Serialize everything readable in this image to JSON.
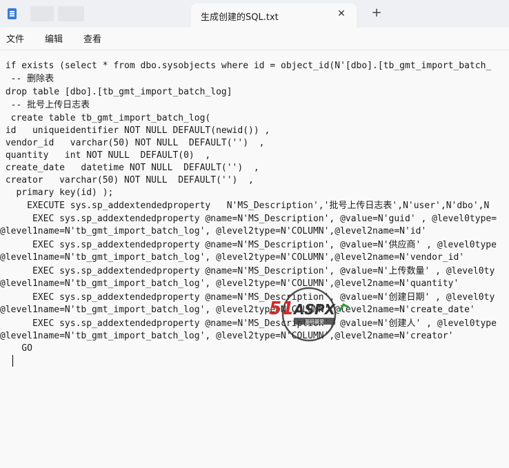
{
  "window": {
    "tab_title": "生成创建的SQL.txt",
    "close_glyph": "✕",
    "new_tab_glyph": "+"
  },
  "menu": {
    "file": "文件",
    "edit": "编辑",
    "view": "查看"
  },
  "editor": {
    "lines": [
      " if exists (select * from dbo.sysobjects where id = object_id(N'[dbo].[tb_gmt_import_batch_",
      "  -- 删除表",
      " drop table [dbo].[tb_gmt_import_batch_log]",
      "  -- 批号上传日志表",
      "  create table tb_gmt_import_batch_log(",
      " id   uniqueidentifier NOT NULL DEFAULT(newid()) ,",
      " vendor_id   varchar(50) NOT NULL  DEFAULT('')  ,",
      " quantity   int NOT NULL  DEFAULT(0)  ,",
      " create_date   datetime NOT NULL  DEFAULT('')  ,",
      " creator   varchar(50) NOT NULL  DEFAULT('')  ,",
      "   primary key(id) );",
      "     EXECUTE sys.sp_addextendedproperty   N'MS_Description','批号上传日志表',N'user',N'dbo',N",
      "      EXEC sys.sp_addextendedproperty @name=N'MS_Description', @value=N'guid' , @level0type=",
      "@level1name=N'tb_gmt_import_batch_log', @level2type=N'COLUMN',@level2name=N'id'",
      "      EXEC sys.sp_addextendedproperty @name=N'MS_Description', @value=N'供应商' , @level0type",
      "@level1name=N'tb_gmt_import_batch_log', @level2type=N'COLUMN',@level2name=N'vendor_id'",
      "      EXEC sys.sp_addextendedproperty @name=N'MS_Description', @value=N'上传数量' , @level0ty",
      "@level1name=N'tb_gmt_import_batch_log', @level2type=N'COLUMN',@level2name=N'quantity'",
      "      EXEC sys.sp_addextendedproperty @name=N'MS_Description', @value=N'创建日期' , @level0ty",
      "@level1name=N'tb_gmt_import_batch_log', @level2type=N'COLUMN',@level2name=N'create_date'",
      "      EXEC sys.sp_addextendedproperty @name=N'MS_Description', @value=N'创建人' , @level0type",
      "@level1name=N'tb_gmt_import_batch_log', @level2type=N'COLUMN',@level2name=N'creator'",
      "    GO"
    ]
  },
  "watermark": {
    "brand": "51ASPX",
    "tagline": "源码最爱"
  },
  "colors": {
    "titlebar_bg": "#eef0f3",
    "editor_bg": "#f9f9f9",
    "text": "#1a1a1a",
    "watermark_red": "#d42a2a",
    "watermark_green": "#2e9a3a"
  }
}
